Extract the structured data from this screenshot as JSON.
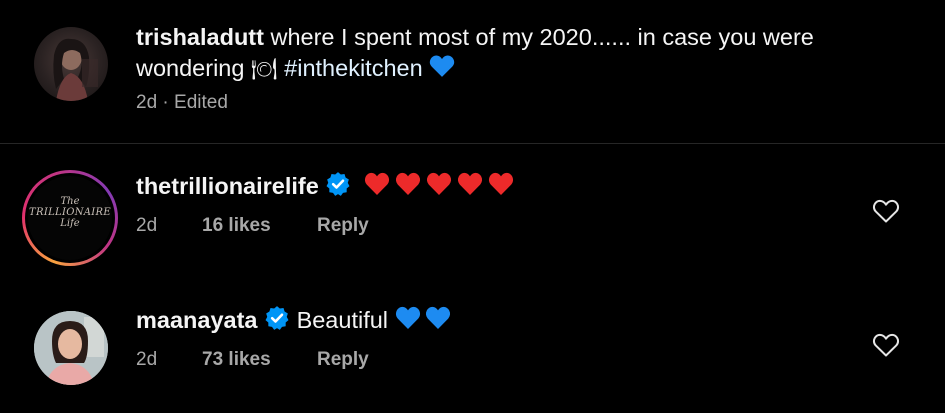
{
  "post": {
    "username": "trishaladutt",
    "caption_part1": " where I spent most of my 2020...... in case you were",
    "caption_part2": "wondering ",
    "caption_emoji": "🍽",
    "hashtag": "#inthekitchen",
    "caption_heart": "💙",
    "time": "2d",
    "separator": "·",
    "edited": "Edited"
  },
  "comments": [
    {
      "username": "thetrillionairelife",
      "text": "",
      "emoji": "❤❤❤❤❤",
      "time": "2d",
      "likes": "16 likes",
      "reply": "Reply",
      "avatar_text_1": "The",
      "avatar_text_2": "TRILLIONAIRE",
      "avatar_text_3": "Life",
      "verified": true,
      "like_icon": "heart-outline-icon"
    },
    {
      "username": "maanayata",
      "text": "Beautiful ",
      "emoji": "💙💙",
      "time": "2d",
      "likes": "73 likes",
      "reply": "Reply",
      "verified": true,
      "like_icon": "heart-outline-icon"
    }
  ],
  "colors": {
    "background": "#000000",
    "text": "#f5f5f5",
    "meta": "#a8a8a8",
    "verified": "#0095f6",
    "red_heart": "#ed2a2a",
    "blue_heart": "#1d8bf1",
    "ring_start": "#f9a33f",
    "ring_end": "#c13584"
  }
}
